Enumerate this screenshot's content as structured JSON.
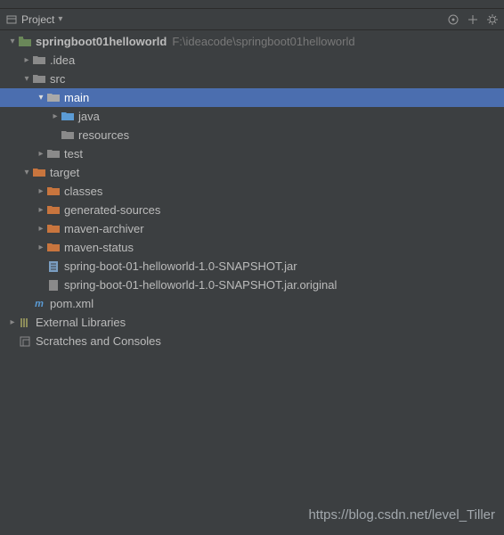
{
  "toolbar": {
    "title": "Project"
  },
  "tree": {
    "root": {
      "name": "springboot01helloworld",
      "path": "F:\\ideacode\\springboot01helloworld"
    },
    "idea_folder": ".idea",
    "src": "src",
    "main": "main",
    "java": "java",
    "resources": "resources",
    "test": "test",
    "target": "target",
    "classes": "classes",
    "generated_sources": "generated-sources",
    "maven_archiver": "maven-archiver",
    "maven_status": "maven-status",
    "jar1": "spring-boot-01-helloworld-1.0-SNAPSHOT.jar",
    "jar2": "spring-boot-01-helloworld-1.0-SNAPSHOT.jar.original",
    "pom": "pom.xml",
    "external_libraries": "External Libraries",
    "scratches": "Scratches and Consoles"
  },
  "watermark": "https://blog.csdn.net/level_Tiller"
}
